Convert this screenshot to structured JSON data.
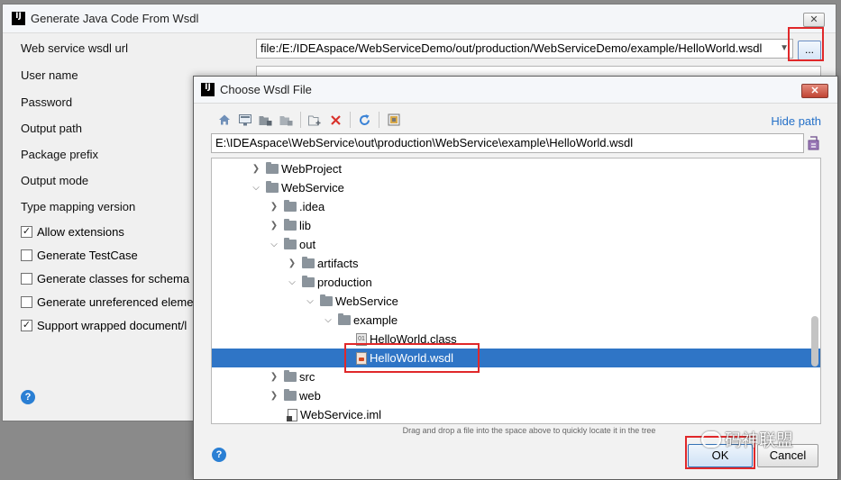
{
  "main_dialog": {
    "title": "Generate Java Code From Wsdl",
    "close_label": "✕",
    "wsdl_url_label": "Web service wsdl url",
    "wsdl_url_value": "file:/E:/IDEAspace/WebServiceDemo/out/production/WebServiceDemo/example/HelloWorld.wsdl",
    "browse_label": "...",
    "labels": {
      "user_name": "User name",
      "password": "Password",
      "output_path": "Output path",
      "package_prefix": "Package prefix",
      "output_mode": "Output mode",
      "type_mapping_version": "Type mapping version"
    },
    "checkboxes": [
      {
        "label": "Allow extensions",
        "checked": true
      },
      {
        "label": "Generate TestCase",
        "checked": false
      },
      {
        "label": "Generate classes for schema a",
        "checked": false
      },
      {
        "label": "Generate unreferenced eleme",
        "checked": false
      },
      {
        "label": "Support wrapped document/l",
        "checked": true
      }
    ],
    "help_label": "?"
  },
  "choose_dialog": {
    "title": "Choose Wsdl File",
    "close_label": "✕",
    "toolbar_icons": [
      "home-icon",
      "desktop-icon",
      "project-folder-icon",
      "module-folder-icon",
      "new-folder-icon",
      "delete-icon",
      "refresh-icon",
      "show-hidden-icon"
    ],
    "hide_path": "Hide path",
    "path_value": "E:\\IDEAspace\\WebService\\out\\production\\WebService\\example\\HelloWorld.wsdl",
    "tree": [
      {
        "label": "WebProject",
        "depth": 0,
        "expanded": false,
        "kind": "folder"
      },
      {
        "label": "WebService",
        "depth": 0,
        "expanded": true,
        "kind": "folder"
      },
      {
        "label": ".idea",
        "depth": 1,
        "expanded": false,
        "kind": "folder"
      },
      {
        "label": "lib",
        "depth": 1,
        "expanded": false,
        "kind": "folder"
      },
      {
        "label": "out",
        "depth": 1,
        "expanded": true,
        "kind": "folder"
      },
      {
        "label": "artifacts",
        "depth": 2,
        "expanded": false,
        "kind": "folder"
      },
      {
        "label": "production",
        "depth": 2,
        "expanded": true,
        "kind": "folder"
      },
      {
        "label": "WebService",
        "depth": 3,
        "expanded": true,
        "kind": "folder"
      },
      {
        "label": "example",
        "depth": 4,
        "expanded": true,
        "kind": "folder"
      },
      {
        "label": "HelloWorld.class",
        "depth": 5,
        "kind": "class"
      },
      {
        "label": "HelloWorld.wsdl",
        "depth": 5,
        "kind": "wsdl",
        "selected": true
      },
      {
        "label": "src",
        "depth": 1,
        "expanded": false,
        "kind": "folder"
      },
      {
        "label": "web",
        "depth": 1,
        "expanded": false,
        "kind": "folder"
      },
      {
        "label": "WebService.iml",
        "depth": 1,
        "kind": "iml"
      }
    ],
    "drag_hint": "Drag and drop a file into the space above to quickly locate it in the tree",
    "ok_label": "OK",
    "cancel_label": "Cancel",
    "help_label": "?"
  },
  "watermark": {
    "text": "码神联盟"
  },
  "colors": {
    "selection": "#2f75c6",
    "link": "#2470c8",
    "highlight_box": "#e0282a"
  }
}
